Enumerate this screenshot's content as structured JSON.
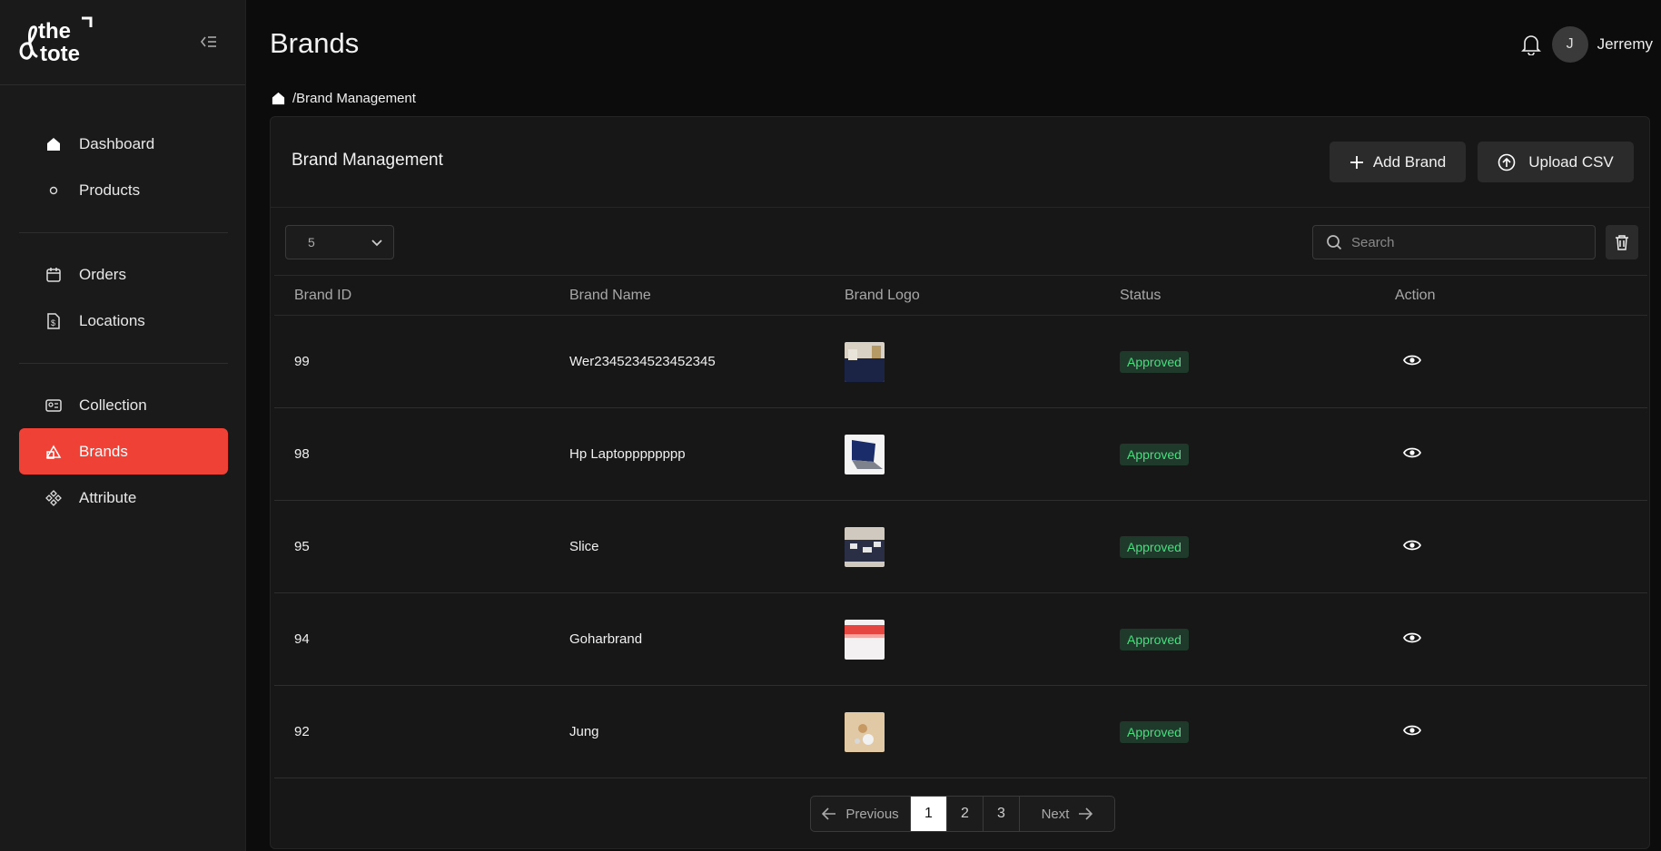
{
  "brand": {
    "logo_text_1": "the",
    "logo_text_2": "tote"
  },
  "sidebar": {
    "items": [
      {
        "label": "Dashboard",
        "icon": "home-icon"
      },
      {
        "label": "Products",
        "icon": "circle-icon"
      },
      {
        "label": "Orders",
        "icon": "calendar-icon"
      },
      {
        "label": "Locations",
        "icon": "file-dollar-icon"
      },
      {
        "label": "Collection",
        "icon": "id-card-icon"
      },
      {
        "label": "Brands",
        "icon": "brands-icon",
        "active": true
      },
      {
        "label": "Attribute",
        "icon": "components-icon"
      }
    ]
  },
  "header": {
    "title": "Brands",
    "user_initial": "J",
    "user_name": "Jerremy"
  },
  "breadcrumb": {
    "text": "/Brand Management"
  },
  "card": {
    "title": "Brand Management",
    "add_label": "Add Brand",
    "upload_label": "Upload CSV",
    "per_page": "5",
    "search_placeholder": "Search"
  },
  "table": {
    "columns": [
      "Brand ID",
      "Brand Name",
      "Brand Logo",
      "Status",
      "Action"
    ],
    "rows": [
      {
        "id": "99",
        "name": "Wer2345234523452345",
        "status": "Approved",
        "logo": "bed-photo"
      },
      {
        "id": "98",
        "name": "Hp Laptopppppppp",
        "status": "Approved",
        "logo": "laptop-photo"
      },
      {
        "id": "95",
        "name": "Slice",
        "status": "Approved",
        "logo": "bedding-photo"
      },
      {
        "id": "94",
        "name": "Goharbrand",
        "status": "Approved",
        "logo": "red-banner-photo"
      },
      {
        "id": "92",
        "name": "Jung",
        "status": "Approved",
        "logo": "beige-product-photo"
      }
    ]
  },
  "pagination": {
    "prev": "Previous",
    "next": "Next",
    "pages": [
      "1",
      "2",
      "3"
    ],
    "current": "1"
  },
  "colors": {
    "accent": "#ef4136",
    "badge_bg": "#1f3a2a",
    "badge_text": "#4ade80",
    "background": "#0c0c0c",
    "sidebar": "#1a1a1a"
  }
}
